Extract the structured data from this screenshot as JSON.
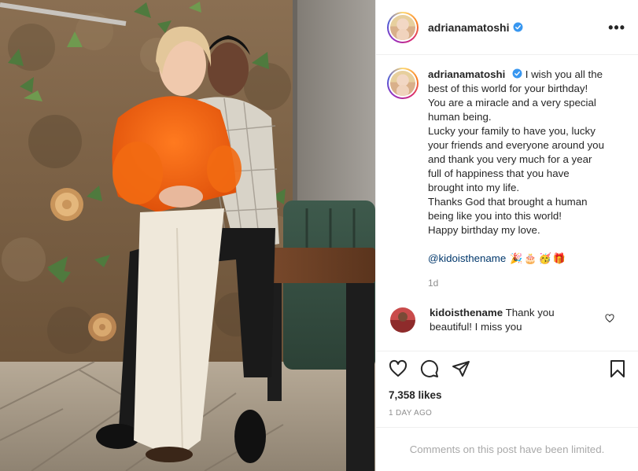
{
  "post": {
    "author": {
      "username": "adrianamatoshi",
      "verified": true
    },
    "caption": {
      "username": "adrianamatoshi",
      "lines": [
        "I wish you all the",
        "best of this world for your birthday!",
        "You are a miracle and a very special",
        "human being.",
        "Lucky your family to have you, lucky",
        "your friends and everyone around you",
        "and thank you very much for a year",
        "full of happiness that you have",
        "brought into my life.",
        "Thanks God that brought a human",
        "being like you into this world!",
        "Happy birthday my love."
      ],
      "mention": "@kidoisthename",
      "emojis": "🎉🎂🥳🎁",
      "time": "1d"
    },
    "reply": {
      "username": "kidoisthename",
      "text": "Thank you",
      "text2": "beautiful! I miss you"
    },
    "likes": "7,358 likes",
    "posted_ago": "1 DAY AGO",
    "comments_limited": "Comments on this post have been limited."
  },
  "icons": {
    "more": "more-options-icon",
    "verified": "verified-badge-icon",
    "like": "heart-icon",
    "comment": "comment-bubble-icon",
    "share": "paper-plane-icon",
    "save": "bookmark-icon"
  },
  "colors": {
    "verified": "#3897f0",
    "mention": "#00376b",
    "muted": "#8e8e8e"
  }
}
